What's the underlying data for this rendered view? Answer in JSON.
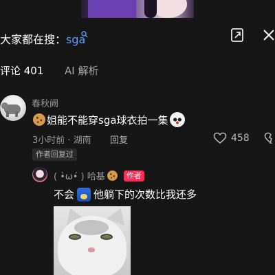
{
  "search": {
    "prefix": "大家都在搜：",
    "query": "sga",
    "search_icon": "search-icon"
  },
  "header_icons": {
    "expand": "expand-icon",
    "close": "close-icon"
  },
  "tabs": [
    {
      "label": "评论 401",
      "active": true
    },
    {
      "label": "AI 解析",
      "active": false
    }
  ],
  "comment": {
    "username": "春秋阙",
    "text": "姐能不能穿sga球衣拍一集",
    "meta": "3小时前 · 湖南",
    "reply_label": "回复",
    "likes": "458",
    "author_replied_tag": "作者回复过"
  },
  "reply": {
    "username": "( •̀ω•́ ) 哈基",
    "author_badge": "作者",
    "text_part1": "不会",
    "text_part2": "他躺下的次数比我还多"
  },
  "colors": {
    "background": "#161616",
    "link": "#5b9bff",
    "author_badge": "#fe2c55",
    "muted": "#9a9a9a"
  }
}
